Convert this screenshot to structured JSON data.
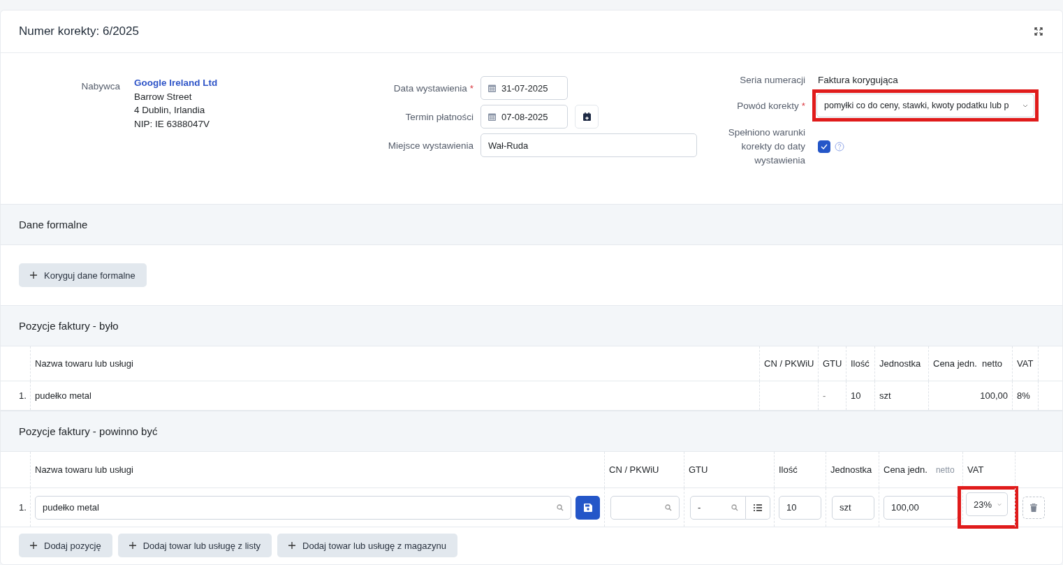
{
  "header": {
    "title": "Numer korekty: 6/2025"
  },
  "buyer": {
    "label": "Nabywca",
    "name": "Google Ireland Ltd",
    "lines": [
      "Barrow Street",
      "4 Dublin, Irlandia",
      "NIP: IE 6388047V"
    ]
  },
  "dates": [
    {
      "label": "Data wystawienia",
      "required_mark": "*",
      "value": "31-07-2025",
      "kind": "date"
    },
    {
      "label": "Termin płatności",
      "value": "07-08-2025",
      "kind": "date-picker"
    },
    {
      "label": "Miejsce wystawienia",
      "value": "Wał-Ruda",
      "kind": "text"
    }
  ],
  "series": {
    "label": "Seria numeracji",
    "value": "Faktura korygująca"
  },
  "reason": {
    "label": "Powód korekty",
    "required_mark": "*",
    "value": "pomyłki co do ceny, stawki, kwoty podatku lub p",
    "highlighted": true
  },
  "conditions": {
    "label": "Spełniono warunki korekty do daty wystawienia",
    "checked": true
  },
  "formal": {
    "title": "Dane formalne",
    "button": "Koryguj dane formalne"
  },
  "before": {
    "title": "Pozycje faktury - było",
    "columns": [
      "Nazwa towaru lub usługi",
      "CN / PKWiU",
      "GTU",
      "Ilość",
      "Jednostka",
      "Cena jedn.  netto",
      "VAT"
    ],
    "rows": [
      {
        "number": "1.",
        "name": "pudełko metal",
        "gtu": "-",
        "qty": "10",
        "unit": "szt",
        "price": "100,00",
        "vat": "8%"
      }
    ]
  },
  "after": {
    "title": "Pozycje faktury - powinno być",
    "columns": [
      {
        "label": "Nazwa towaru lub usługi"
      },
      {
        "label": "CN / PKWiU"
      },
      {
        "label": "GTU"
      },
      {
        "label": "Ilość"
      },
      {
        "label": "Jednostka"
      },
      {
        "label": "Cena jedn.",
        "note": "netto"
      },
      {
        "label": "VAT"
      }
    ],
    "rows": [
      {
        "number": "1.",
        "name": "pudełko metal",
        "gtu": "-",
        "qty": "10",
        "unit": "szt",
        "price": "100,00",
        "vat": "23%",
        "vat_highlighted": true
      }
    ]
  },
  "add_buttons": [
    "Dodaj pozycję",
    "Dodaj towar lub usługę z listy",
    "Dodaj towar lub usługę z magazynu"
  ]
}
